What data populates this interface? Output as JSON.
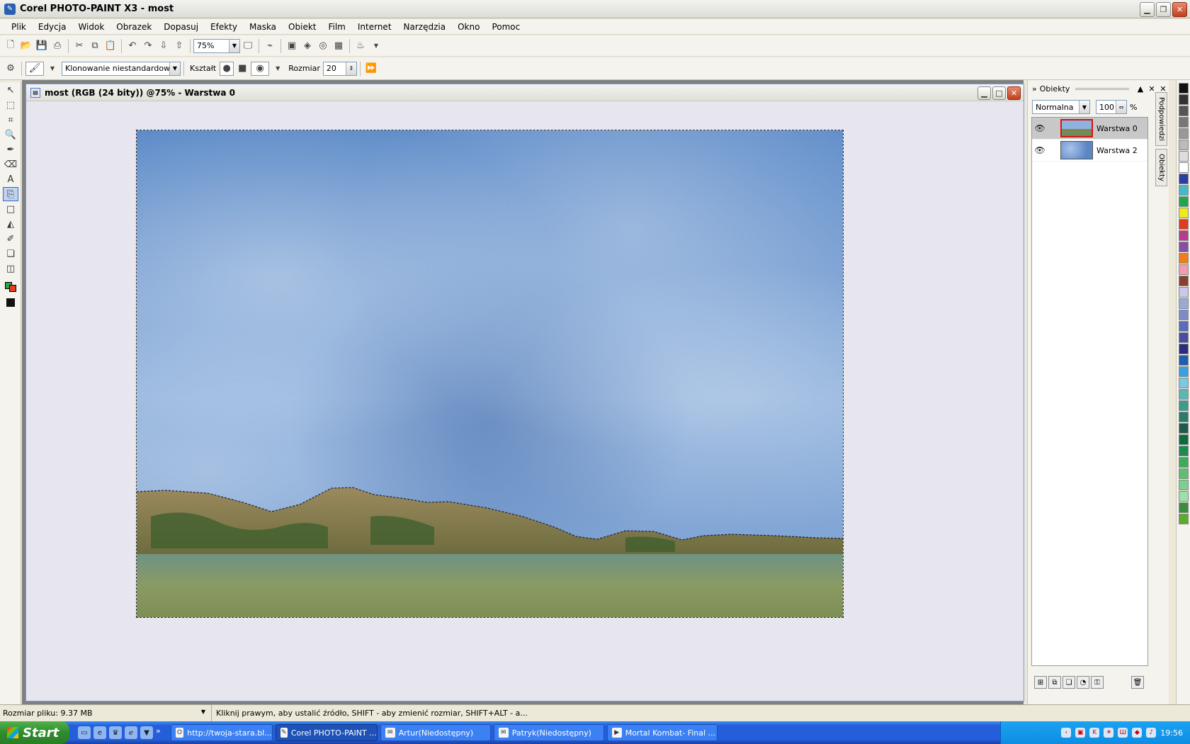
{
  "app": {
    "title": "Corel PHOTO-PAINT X3 - most"
  },
  "menu": [
    "Plik",
    "Edycja",
    "Widok",
    "Obrazek",
    "Dopasuj",
    "Efekty",
    "Maska",
    "Obiekt",
    "Film",
    "Internet",
    "Narzędzia",
    "Okno",
    "Pomoc"
  ],
  "toolbar": {
    "zoom": "75%"
  },
  "property_bar": {
    "brush_type": "Klonowanie niestandardowe",
    "shape_label": "Kształt",
    "size_label": "Rozmiar",
    "size_value": "20"
  },
  "document": {
    "title": "most (RGB (24 bity)) @75% - Warstwa 0"
  },
  "objects_docker": {
    "title": "Obiekty",
    "blend_mode": "Normalna",
    "opacity": "100",
    "opacity_unit": "%",
    "layers": [
      {
        "name": "Warstwa 0",
        "visible": true,
        "selected": true
      },
      {
        "name": "Warstwa 2",
        "visible": true,
        "selected": false
      }
    ],
    "side_tabs": [
      "Podpowiedzi",
      "Obiekty"
    ]
  },
  "palette_colors": [
    "#111111",
    "#333333",
    "#555555",
    "#777777",
    "#999999",
    "#bbbbbb",
    "#dddddd",
    "#ffffff",
    "#2b3f9e",
    "#48b8c8",
    "#23a54a",
    "#f2e81e",
    "#e23a1e",
    "#b53c8c",
    "#8a4ea0",
    "#ef7d1a",
    "#f59bb0",
    "#8a4030",
    "#c8c8e8",
    "#9aaad8",
    "#7c8cc8",
    "#5c6cb8",
    "#4c4ca0",
    "#2c2c7c",
    "#1e5eb0",
    "#3aa0e0",
    "#7cc8e0",
    "#5fb4b4",
    "#3c9c8c",
    "#2c7c6c",
    "#1c5c4c",
    "#0c6c3c",
    "#1c8c4c",
    "#3cac5c",
    "#5cc06c",
    "#7cd08c",
    "#9ce0ac",
    "#3c8c3c",
    "#5cac2c"
  ],
  "status": {
    "file_size": "Rozmiar pliku: 9.37 MB",
    "message": "Kliknij prawym, aby ustalić źródło, SHIFT - aby zmienić rozmiar, SHIFT+ALT - a..."
  },
  "taskbar": {
    "start": "Start",
    "tasks": [
      {
        "label": "http://twoja-stara.bl...",
        "active": false
      },
      {
        "label": "Corel PHOTO-PAINT ...",
        "active": true
      },
      {
        "label": "Artur(Niedostępny)",
        "active": false
      },
      {
        "label": "Patryk(Niedostępny)",
        "active": false
      },
      {
        "label": "Mortal Kombat- Final ...",
        "active": false
      }
    ],
    "clock": "19:56"
  }
}
